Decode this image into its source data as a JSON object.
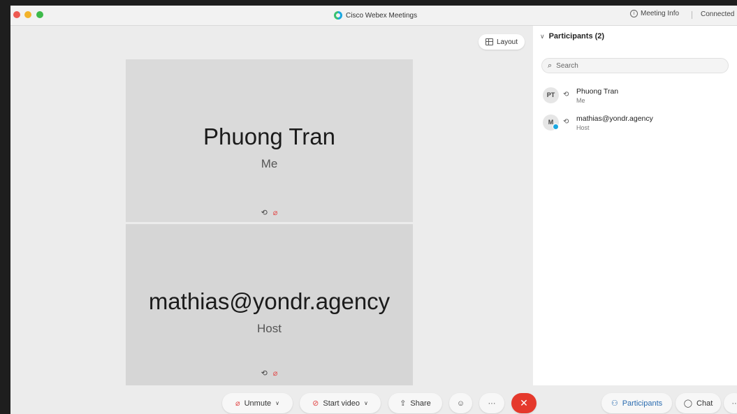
{
  "window": {
    "title": "Cisco Webex Meetings",
    "meeting_info_label": "Meeting Info",
    "status_text": "Connected"
  },
  "stage": {
    "layout_label": "Layout",
    "tiles": [
      {
        "name": "Phuong Tran",
        "role": "Me"
      },
      {
        "name": "mathias@yondr.agency",
        "role": "Host"
      }
    ]
  },
  "participants_panel": {
    "title": "Participants (2)",
    "search_placeholder": "Search",
    "participants": [
      {
        "initials": "PT",
        "name": "Phuong Tran",
        "role": "Me"
      },
      {
        "initials": "M",
        "name": "mathias@yondr.agency",
        "role": "Host"
      }
    ]
  },
  "toolbar": {
    "unmute_label": "Unmute",
    "start_video_label": "Start video",
    "share_label": "Share",
    "participants_label": "Participants",
    "chat_label": "Chat"
  },
  "icons": {
    "mic_muted": "mic-muted-icon",
    "video_off": "video-off-icon",
    "share": "share-icon",
    "emoji": "emoji-icon",
    "more": "more-icon",
    "end_call": "end-call-icon",
    "participants": "participants-icon",
    "chat": "chat-icon",
    "search": "search-icon",
    "layout": "layout-grid-icon"
  },
  "colors": {
    "end_call": "#e5392c",
    "muted": "#e24a4a",
    "participants_active": "#2b6cb0",
    "webex_blue": "#1ba7e0"
  }
}
